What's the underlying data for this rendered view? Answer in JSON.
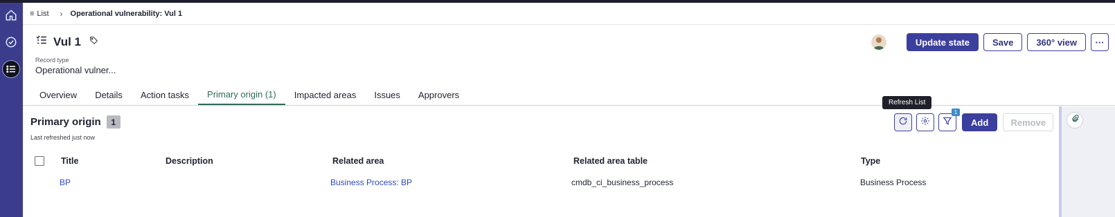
{
  "breadcrumb": {
    "list_label": "List",
    "current": "Operational vulnerability: Vul 1"
  },
  "record": {
    "title": "Vul 1",
    "type_label": "Record type",
    "type_value": "Operational vulner..."
  },
  "header_actions": {
    "update_state": "Update state",
    "save": "Save",
    "view360": "360° view",
    "more": "···"
  },
  "tabs": [
    {
      "label": "Overview",
      "active": false
    },
    {
      "label": "Details",
      "active": false
    },
    {
      "label": "Action tasks",
      "active": false
    },
    {
      "label": "Primary origin (1)",
      "active": true
    },
    {
      "label": "Impacted areas",
      "active": false
    },
    {
      "label": "Issues",
      "active": false
    },
    {
      "label": "Approvers",
      "active": false
    }
  ],
  "section": {
    "title": "Primary origin",
    "count": "1",
    "last_refreshed": "Last refreshed just now"
  },
  "list_actions": {
    "tooltip": "Refresh List",
    "filter_count": "1",
    "add": "Add",
    "remove": "Remove"
  },
  "table": {
    "headers": [
      "Title",
      "Description",
      "Related area",
      "Related area table",
      "Type"
    ],
    "rows": [
      {
        "title": "BP",
        "description": "",
        "related_area": "Business Process: BP",
        "related_area_table": "cmdb_ci_business_process",
        "type": "Business Process"
      }
    ]
  },
  "colors": {
    "rail": "#3b3d8c",
    "primary": "#3b3f9e",
    "active_tab": "#2e6b5a",
    "link": "#2f4bb8"
  },
  "icons": {
    "rail": [
      "home-icon",
      "check-circle-icon",
      "list-icon"
    ],
    "title": "list-check-icon",
    "tag": "tag-icon",
    "refresh": "refresh-icon",
    "settings": "gear-icon",
    "filter": "filter-icon",
    "attachment": "paperclip-icon"
  }
}
